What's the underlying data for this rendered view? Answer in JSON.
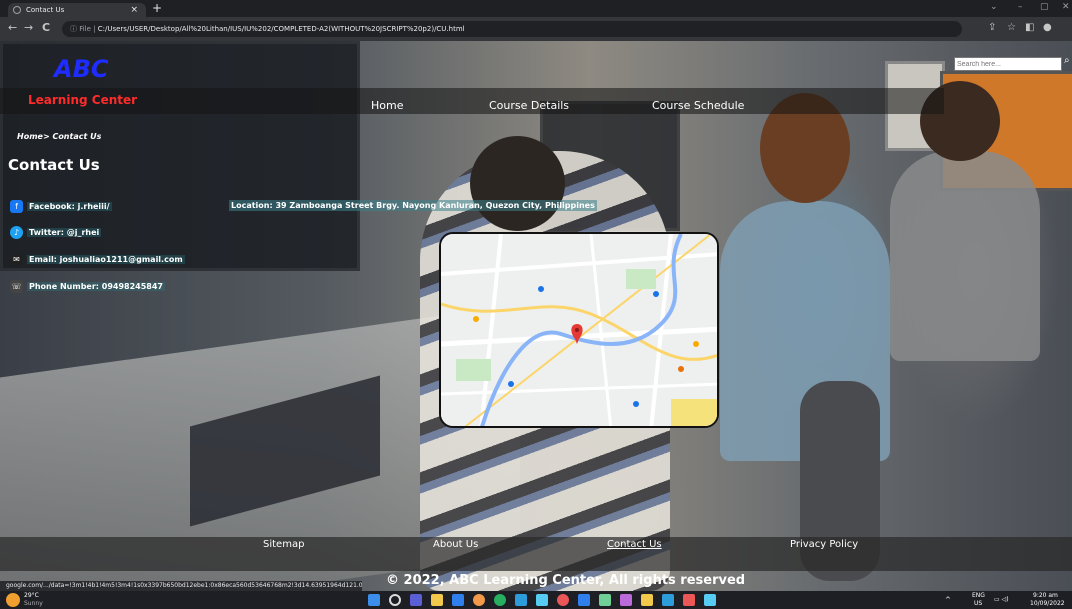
{
  "browser": {
    "tab_title": "Contact Us",
    "tab_close": "×",
    "new_tab": "+",
    "window_controls": [
      "⌄",
      "–",
      "▢",
      "✕"
    ],
    "nav_buttons": [
      "←",
      "→",
      "C"
    ],
    "address_prefix": "ⓘ File | ",
    "address": "C:/Users/USER/Desktop/All%20Lithan/IUS/IU%202/COMPLETED-A2(WITHOUT%20JSCRIPT%20p2)/CU.html",
    "status_url": "google.com/.../data=!3m1!4b1!4m5!3m4!1s0x3397b650bd12ebe1:0x86eca560d53646768m2!3d14.63951964d121.0..."
  },
  "header": {
    "logo_abc": "ABC",
    "logo_subtitle": "Learning Center",
    "nav": [
      "Home",
      "Course Details",
      "Course Schedule"
    ],
    "search_placeholder": "Search here..."
  },
  "breadcrumb": "Home> Contact Us",
  "page_title": "Contact Us",
  "contacts": [
    {
      "label": "Facebook: j.rheiii/",
      "icon": "facebook-icon",
      "color": "#1877f2"
    },
    {
      "label": "Twitter: @j_rhei",
      "icon": "twitter-icon",
      "color": "#1da1f2"
    },
    {
      "label": "Email: joshualiao1211@gmail.com",
      "icon": "email-icon",
      "color": "#202020"
    },
    {
      "label": "Phone Number: 09498245847",
      "icon": "phone-icon",
      "color": "#444444"
    }
  ],
  "location": "Location: 39 Zamboanga Street Brgy. Nayong Kanluran, Quezon City, Philippines",
  "footer": {
    "links": [
      "Sitemap",
      "About Us",
      "Contact Us",
      "Privacy Policy"
    ],
    "copyright": "© 2022, ABC Learning Center, All rights reserved"
  },
  "taskbar": {
    "temperature": "29°C",
    "weather": "Sunny",
    "lang": "ENG",
    "region": "US",
    "time": "9:20 am",
    "date": "10/09/2022"
  },
  "colors": {
    "logo_abc": "#1f2cff",
    "logo_subtitle": "#ff2b2b",
    "map_pin": "#e53935"
  }
}
